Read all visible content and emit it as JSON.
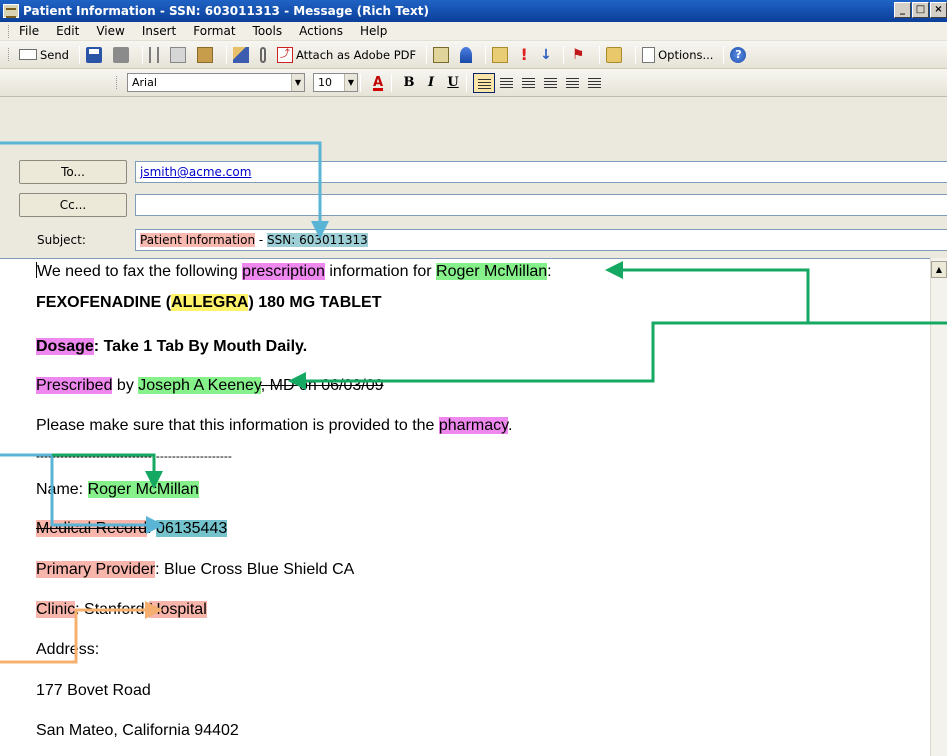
{
  "window": {
    "title": "Patient Information - SSN: 603011313 - Message (Rich Text)",
    "buttons": [
      "_",
      "□",
      "×"
    ]
  },
  "menu": [
    "File",
    "Edit",
    "View",
    "Insert",
    "Format",
    "Tools",
    "Actions",
    "Help"
  ],
  "toolbar": {
    "send_label": "Send",
    "attach_pdf_label": "Attach as Adobe PDF",
    "options_label": "Options...",
    "font_name": "Arial",
    "font_size": "10"
  },
  "header": {
    "to_button": "To...",
    "cc_button": "Cc...",
    "subject_label": "Subject:",
    "to_value": "jsmith@acme.com",
    "cc_value": "",
    "subject_part1": "Patient Information",
    "subject_part2": " - ",
    "subject_part3": "SSN: 603011313"
  },
  "body": {
    "line1": {
      "a": "We need to fax the following ",
      "b": "prescription",
      "c": " information for ",
      "d": "Roger McMillan",
      "e": ":"
    },
    "line2": {
      "a": "FEXOFENADINE (",
      "b": "ALLEGRA",
      "c": ") 180 MG TABLET"
    },
    "line3": {
      "a": "Dosage",
      "b": ": Take 1 Tab By Mouth Daily."
    },
    "line4": {
      "a": "Prescribed",
      "b": " by ",
      "c": "Joseph A Keeney",
      "d": ", MD on 06/03/09"
    },
    "line5": {
      "a": "Please make sure that this information is provided to the ",
      "b": "pharmacy",
      "c": "."
    },
    "divider": "-------------------------------------------------",
    "name": {
      "label": "Name: ",
      "value": "Roger McMillan"
    },
    "record": {
      "label": "Medical Record",
      "sep": ": ",
      "value": "06135443"
    },
    "provider": {
      "label": "Primary Provider",
      "value": ": Blue Cross Blue Shield CA"
    },
    "clinic": {
      "label": "Clinic",
      "mid": ": Stanford ",
      "value": "Hospital"
    },
    "address_label": "Address:",
    "address1": "177 Bovet Road",
    "address2": "San Mateo, California 94402"
  },
  "colors": {
    "arrow_blue": "#5ab4d6",
    "arrow_green": "#14a862",
    "arrow_orange": "#f5b070"
  }
}
